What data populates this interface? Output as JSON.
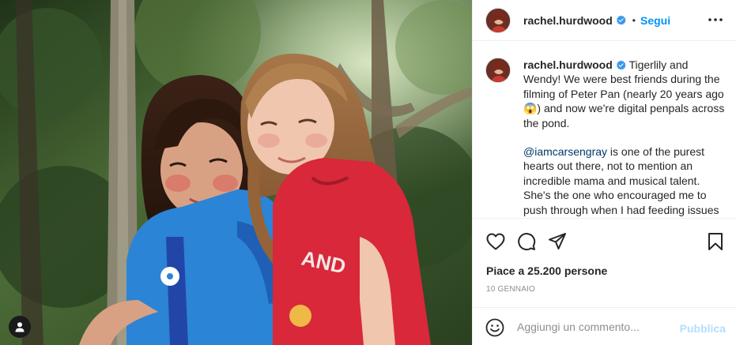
{
  "post": {
    "username": "rachel.hurdwood",
    "follow_dot": "•",
    "follow_label": "Segui",
    "verified_icon": "verified-badge-icon"
  },
  "caption": {
    "username": "rachel.hurdwood",
    "paragraph1": "Tigerlily and Wendy! We were best friends during the filming of Peter Pan (nearly 20 years ago 😱) and now we're digital penpals across the pond.",
    "mention": "@iamcarsengray",
    "paragraph2_rest": " is one of the purest hearts out there, not to mention an incredible mama and musical talent. She's the one who encouraged me to push through when I had feeding issues"
  },
  "actions": {
    "icons": [
      "heart-icon",
      "comment-icon",
      "share-icon",
      "bookmark-icon"
    ],
    "likes_text": "Piace a 25.200 persone",
    "date": "10 GENNAIO"
  },
  "comment": {
    "placeholder": "Aggiungi un commento...",
    "post_label": "Pubblica",
    "emoji_icon": "emoji-icon"
  },
  "colors": {
    "accent": "#0095f6",
    "post_disabled": "#b2dffc",
    "mention": "#00376b",
    "meta": "#8e8e8e"
  }
}
